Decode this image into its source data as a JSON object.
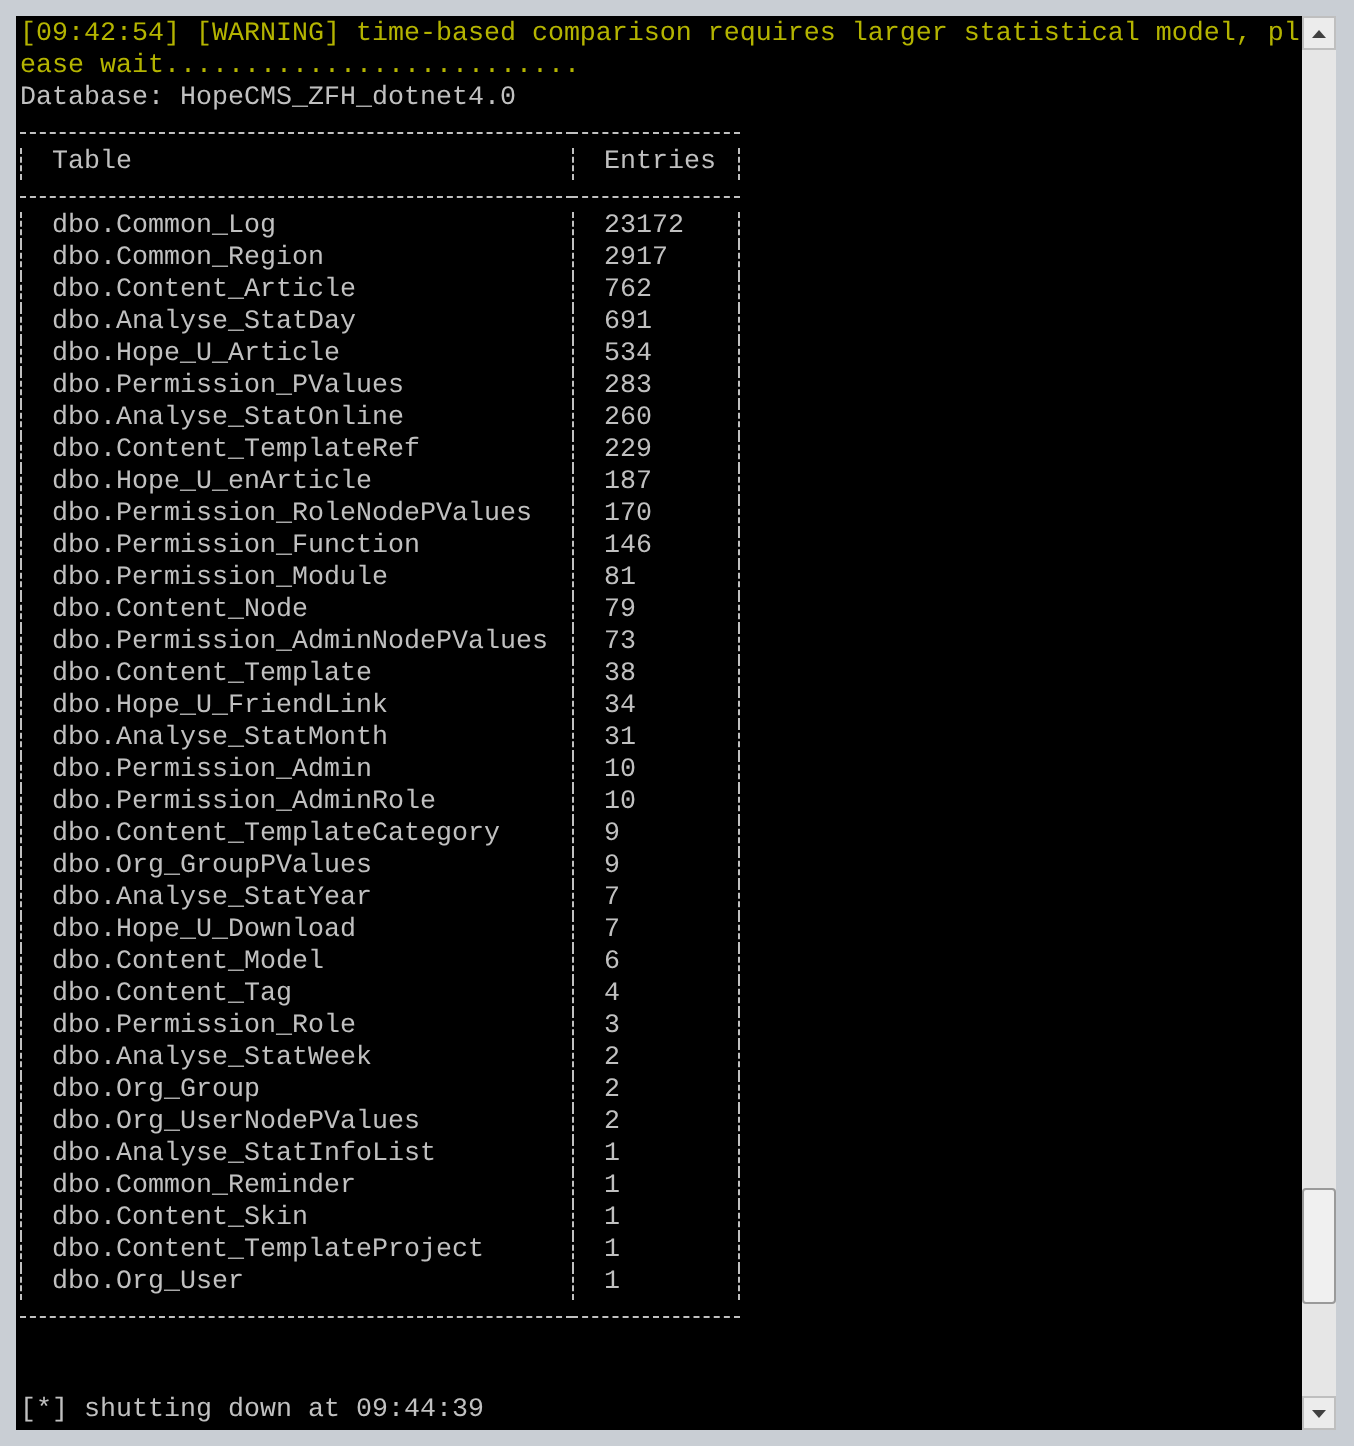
{
  "console": {
    "lines": [
      {
        "kind": "warning",
        "text": "[09:42:54] [WARNING] time-based comparison requires larger statistical model, pl"
      },
      {
        "kind": "warning",
        "text": "ease wait.........................."
      },
      {
        "kind": "plain",
        "text": "Database: HopeCMS_ZFH_dotnet4.0"
      }
    ],
    "table": {
      "columns": [
        "Table",
        "Entries"
      ],
      "rows": [
        [
          "dbo.Common_Log",
          "23172"
        ],
        [
          "dbo.Common_Region",
          "2917"
        ],
        [
          "dbo.Content_Article",
          "762"
        ],
        [
          "dbo.Analyse_StatDay",
          "691"
        ],
        [
          "dbo.Hope_U_Article",
          "534"
        ],
        [
          "dbo.Permission_PValues",
          "283"
        ],
        [
          "dbo.Analyse_StatOnline",
          "260"
        ],
        [
          "dbo.Content_TemplateRef",
          "229"
        ],
        [
          "dbo.Hope_U_enArticle",
          "187"
        ],
        [
          "dbo.Permission_RoleNodePValues",
          "170"
        ],
        [
          "dbo.Permission_Function",
          "146"
        ],
        [
          "dbo.Permission_Module",
          "81"
        ],
        [
          "dbo.Content_Node",
          "79"
        ],
        [
          "dbo.Permission_AdminNodePValues",
          "73"
        ],
        [
          "dbo.Content_Template",
          "38"
        ],
        [
          "dbo.Hope_U_FriendLink",
          "34"
        ],
        [
          "dbo.Analyse_StatMonth",
          "31"
        ],
        [
          "dbo.Permission_Admin",
          "10"
        ],
        [
          "dbo.Permission_AdminRole",
          "10"
        ],
        [
          "dbo.Content_TemplateCategory",
          "9"
        ],
        [
          "dbo.Org_GroupPValues",
          "9"
        ],
        [
          "dbo.Analyse_StatYear",
          "7"
        ],
        [
          "dbo.Hope_U_Download",
          "7"
        ],
        [
          "dbo.Content_Model",
          "6"
        ],
        [
          "dbo.Content_Tag",
          "4"
        ],
        [
          "dbo.Permission_Role",
          "3"
        ],
        [
          "dbo.Analyse_StatWeek",
          "2"
        ],
        [
          "dbo.Org_Group",
          "2"
        ],
        [
          "dbo.Org_UserNodePValues",
          "2"
        ],
        [
          "dbo.Analyse_StatInfoList",
          "1"
        ],
        [
          "dbo.Common_Reminder",
          "1"
        ],
        [
          "dbo.Content_Skin",
          "1"
        ],
        [
          "dbo.Content_TemplateProject",
          "1"
        ],
        [
          "dbo.Org_User",
          "1"
        ]
      ]
    },
    "footer": {
      "kind": "plain",
      "text": "[*] shutting down at 09:44:39"
    }
  }
}
